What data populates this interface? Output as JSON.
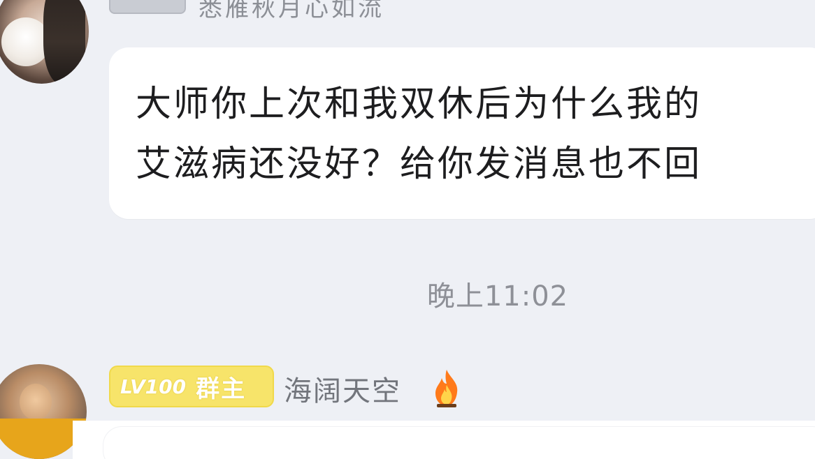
{
  "top_message": {
    "sender_name": "悉雁秋月心如流"
  },
  "main_message": {
    "line1": "大师你上次和我双休后为什么我的",
    "line2": "艾滋病还没好？给你发消息也不回"
  },
  "timestamp": "晚上11:02",
  "bottom_message": {
    "level": "LV100",
    "role": "群主",
    "sender_name": "海阔天空",
    "icon": "fire-icon"
  },
  "colors": {
    "background": "#eef0f5",
    "bubble": "#ffffff",
    "badge_yellow": "#f7e46a",
    "fire_orange": "#ff7a1a"
  }
}
